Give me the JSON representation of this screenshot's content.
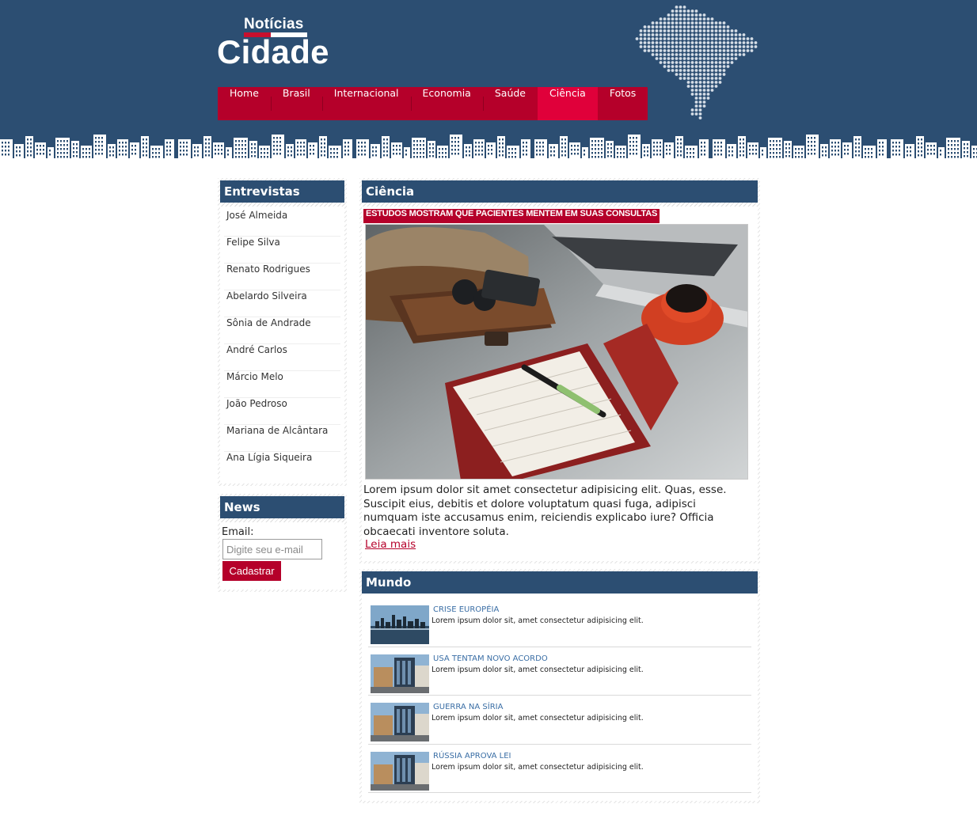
{
  "logo": {
    "small": "Notícias",
    "big": "Cidade"
  },
  "nav": {
    "items": [
      {
        "label": "Home",
        "active": false
      },
      {
        "label": "Brasil",
        "active": false
      },
      {
        "label": "Internacional",
        "active": false
      },
      {
        "label": "Economia",
        "active": false
      },
      {
        "label": "Saúde",
        "active": false
      },
      {
        "label": "Ciência",
        "active": true
      },
      {
        "label": "Fotos",
        "active": false
      }
    ]
  },
  "sidebar": {
    "interviews": {
      "title": "Entrevistas",
      "items": [
        "José Almeida",
        "Felipe Silva",
        "Renato Rodrigues",
        "Abelardo Silveira",
        "Sônia de Andrade",
        "André Carlos",
        "Márcio Melo",
        "João Pedroso",
        "Mariana de Alcântara",
        "Ana Lígia Siqueira"
      ]
    },
    "newsletter": {
      "title": "News",
      "email_label": "Email:",
      "email_placeholder": "Digite seu e-mail",
      "email_value": "",
      "submit_label": "Cadastrar"
    }
  },
  "science": {
    "title": "Ciência",
    "headline": "ESTUDOS MOSTRAM QUE PACIENTES MENTEM EM SUAS CONSULTAS",
    "body": "Lorem ipsum dolor sit amet consectetur adipisicing elit. Quas, esse. Suscipit eius, debitis et dolore voluptatum quasi fuga, adipisci numquam iste accusamus enim, reiciendis explicabo iure? Officia obcaecati inventore soluta.",
    "read_more": "Leia mais"
  },
  "world": {
    "title": "Mundo",
    "items": [
      {
        "title": "CRISE EUROPÉIA",
        "desc": "Lorem ipsum dolor sit, amet consectetur adipisicing elit."
      },
      {
        "title": "USA TENTAM NOVO ACORDO",
        "desc": "Lorem ipsum dolor sit, amet consectetur adipisicing elit."
      },
      {
        "title": "GUERRA NA SÍRIA",
        "desc": "Lorem ipsum dolor sit, amet consectetur adipisicing elit."
      },
      {
        "title": "RÚSSIA APROVA LEI",
        "desc": "Lorem ipsum dolor sit, amet consectetur adipisicing elit."
      }
    ]
  },
  "colors": {
    "navy": "#2c4e72",
    "brand_red": "#b5002a",
    "active_red": "#e0003a",
    "link_blue": "#3a6ea5"
  }
}
